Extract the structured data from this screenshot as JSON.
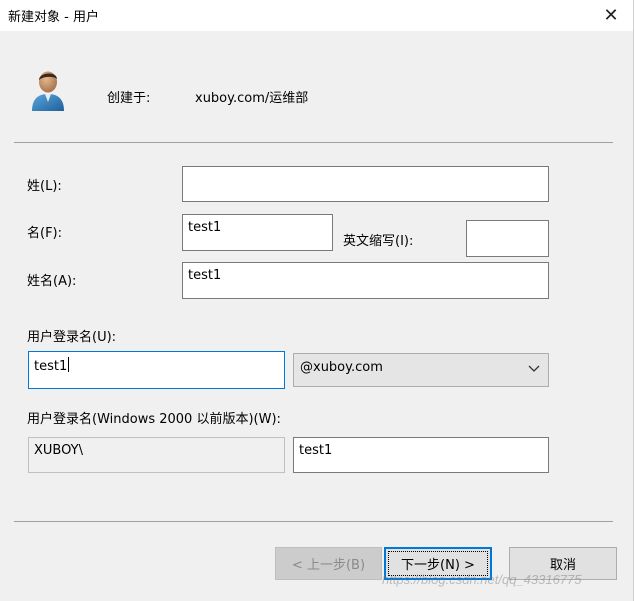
{
  "window": {
    "title": "新建对象 - 用户",
    "close_glyph": "✕"
  },
  "header": {
    "icon": "user-icon",
    "created_in_label": "创建于:",
    "created_in_value": "xuboy.com/运维部"
  },
  "form": {
    "last_name": {
      "label": "姓(L):",
      "value": ""
    },
    "first_name": {
      "label": "名(F):",
      "value": "test1"
    },
    "initials": {
      "label": "英文缩写(I):",
      "value": ""
    },
    "full_name": {
      "label": "姓名(A):",
      "value": "test1"
    },
    "logon_name": {
      "label": "用户登录名(U):",
      "value": "test1",
      "domain_selected": "@xuboy.com"
    },
    "pre2000_logon": {
      "label": "用户登录名(Windows 2000 以前版本)(W):",
      "domain_prefix": "XUBOY\\",
      "value": "test1"
    }
  },
  "buttons": {
    "back": "< 上一步(B)",
    "next": "下一步(N) >",
    "cancel": "取消"
  },
  "watermark": "https://blog.csdn.net/qq_43316775",
  "colors": {
    "dialog_bg": "#f0f0f0",
    "titlebar_bg": "#ffffff",
    "focus_border": "#0078d7",
    "field_border": "#7a7a7a"
  }
}
